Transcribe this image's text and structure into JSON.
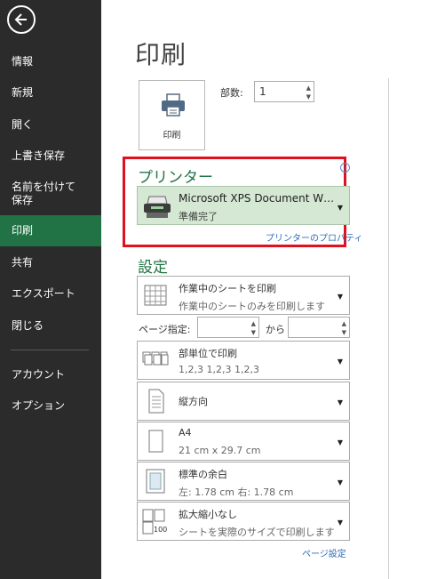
{
  "sidebar": {
    "items": [
      {
        "label": "情報"
      },
      {
        "label": "新規"
      },
      {
        "label": "開く"
      },
      {
        "label": "上書き保存"
      },
      {
        "label": "名前を付けて保存"
      },
      {
        "label": "印刷"
      },
      {
        "label": "共有"
      },
      {
        "label": "エクスポート"
      },
      {
        "label": "閉じる"
      },
      {
        "label": "アカウント"
      },
      {
        "label": "オプション"
      }
    ]
  },
  "main": {
    "title": "印刷",
    "print_button_label": "印刷",
    "copies_label": "部数:",
    "copies_value": "1",
    "printer_heading": "プリンター",
    "printer_info_icon": "i",
    "printer_name": "Microsoft XPS Document W…",
    "printer_status": "準備完了",
    "printer_properties_link": "プリンターのプロパティ",
    "settings_heading": "設定",
    "settings": [
      {
        "title": "作業中のシートを印刷",
        "subtitle": "作業中のシートのみを印刷します",
        "icon": "sheet-grid-icon"
      },
      {
        "title": "部単位で印刷",
        "subtitle": "1,2,3    1,2,3    1,2,3",
        "icon": "collate-icon"
      },
      {
        "title": "縦方向",
        "subtitle": "",
        "icon": "portrait-icon"
      },
      {
        "title": "A4",
        "subtitle": "21 cm x 29.7 cm",
        "icon": "paper-size-icon"
      },
      {
        "title": "標準の余白",
        "subtitle": "左:  1.78 cm    右:  1.78 cm",
        "icon": "margins-icon"
      },
      {
        "title": "拡大縮小なし",
        "subtitle": "シートを実際のサイズで印刷します",
        "icon": "scaling-icon"
      }
    ],
    "pages_label": "ページ指定:",
    "pages_to_label": "から",
    "pages_from_value": "",
    "pages_to_value": "",
    "page_setup_link": "ページ設定"
  },
  "colors": {
    "accent": "#217346",
    "sidebar": "#2b2b2b",
    "highlight": "#e0101f"
  }
}
